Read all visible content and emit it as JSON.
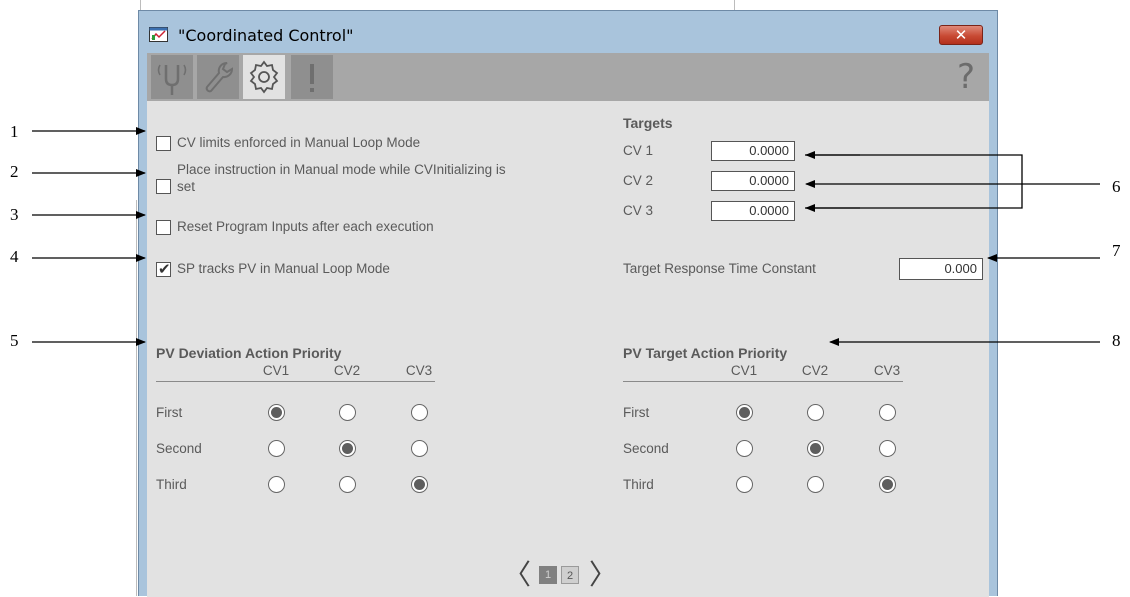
{
  "window": {
    "title": "\"Coordinated Control\"",
    "close_label": "✕",
    "help_label": "?"
  },
  "toolbar": {
    "tabs": [
      {
        "name": "diagnostics-tab",
        "icon": "tuning-fork-icon",
        "active": false
      },
      {
        "name": "maintenance-tab",
        "icon": "wrench-icon",
        "active": false
      },
      {
        "name": "configuration-tab",
        "icon": "gear-icon",
        "active": true
      },
      {
        "name": "alarms-tab",
        "icon": "exclamation-icon",
        "active": false
      }
    ]
  },
  "options": [
    {
      "label": "CV limits enforced in Manual Loop Mode",
      "checked": false
    },
    {
      "label_line1": "Place instruction in Manual mode while CVInitializing is",
      "label_line2": "set",
      "checked": false
    },
    {
      "label": "Reset Program Inputs after each execution",
      "checked": false
    },
    {
      "label": "SP tracks PV in Manual Loop Mode",
      "checked": true
    }
  ],
  "targets": {
    "heading": "Targets",
    "rows": [
      {
        "label": "CV 1",
        "value": "0.0000"
      },
      {
        "label": "CV 2",
        "value": "0.0000"
      },
      {
        "label": "CV 3",
        "value": "0.0000"
      }
    ],
    "response_label": "Target Response Time Constant",
    "response_value": "0.000"
  },
  "pv_deviation": {
    "heading": "PV Deviation Action Priority",
    "columns": [
      "CV1",
      "CV2",
      "CV3"
    ],
    "rows": [
      {
        "label": "First",
        "selected": 0
      },
      {
        "label": "Second",
        "selected": 1
      },
      {
        "label": "Third",
        "selected": 2
      }
    ]
  },
  "pv_target": {
    "heading": "PV Target Action Priority",
    "columns": [
      "CV1",
      "CV2",
      "CV3"
    ],
    "rows": [
      {
        "label": "First",
        "selected": 0
      },
      {
        "label": "Second",
        "selected": 1
      },
      {
        "label": "Third",
        "selected": 2
      }
    ]
  },
  "pager": {
    "prev": "〈",
    "next": "〉",
    "pages": [
      "1",
      "2"
    ],
    "current": "1"
  },
  "callouts": [
    "1",
    "2",
    "3",
    "4",
    "5",
    "6",
    "7",
    "8"
  ],
  "colors": {
    "window_frame": "#a9c4dc",
    "panel": "#e2e2e2",
    "toolbar": "#a7a7a7",
    "close_button": "#c84a34"
  }
}
